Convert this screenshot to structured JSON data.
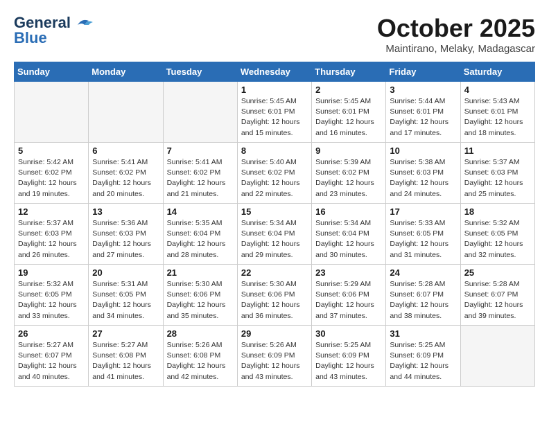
{
  "header": {
    "logo_line1": "General",
    "logo_line2": "Blue",
    "month": "October 2025",
    "location": "Maintirano, Melaky, Madagascar"
  },
  "weekdays": [
    "Sunday",
    "Monday",
    "Tuesday",
    "Wednesday",
    "Thursday",
    "Friday",
    "Saturday"
  ],
  "weeks": [
    [
      {
        "day": "",
        "info": ""
      },
      {
        "day": "",
        "info": ""
      },
      {
        "day": "",
        "info": ""
      },
      {
        "day": "1",
        "info": "Sunrise: 5:45 AM\nSunset: 6:01 PM\nDaylight: 12 hours\nand 15 minutes."
      },
      {
        "day": "2",
        "info": "Sunrise: 5:45 AM\nSunset: 6:01 PM\nDaylight: 12 hours\nand 16 minutes."
      },
      {
        "day": "3",
        "info": "Sunrise: 5:44 AM\nSunset: 6:01 PM\nDaylight: 12 hours\nand 17 minutes."
      },
      {
        "day": "4",
        "info": "Sunrise: 5:43 AM\nSunset: 6:01 PM\nDaylight: 12 hours\nand 18 minutes."
      }
    ],
    [
      {
        "day": "5",
        "info": "Sunrise: 5:42 AM\nSunset: 6:02 PM\nDaylight: 12 hours\nand 19 minutes."
      },
      {
        "day": "6",
        "info": "Sunrise: 5:41 AM\nSunset: 6:02 PM\nDaylight: 12 hours\nand 20 minutes."
      },
      {
        "day": "7",
        "info": "Sunrise: 5:41 AM\nSunset: 6:02 PM\nDaylight: 12 hours\nand 21 minutes."
      },
      {
        "day": "8",
        "info": "Sunrise: 5:40 AM\nSunset: 6:02 PM\nDaylight: 12 hours\nand 22 minutes."
      },
      {
        "day": "9",
        "info": "Sunrise: 5:39 AM\nSunset: 6:02 PM\nDaylight: 12 hours\nand 23 minutes."
      },
      {
        "day": "10",
        "info": "Sunrise: 5:38 AM\nSunset: 6:03 PM\nDaylight: 12 hours\nand 24 minutes."
      },
      {
        "day": "11",
        "info": "Sunrise: 5:37 AM\nSunset: 6:03 PM\nDaylight: 12 hours\nand 25 minutes."
      }
    ],
    [
      {
        "day": "12",
        "info": "Sunrise: 5:37 AM\nSunset: 6:03 PM\nDaylight: 12 hours\nand 26 minutes."
      },
      {
        "day": "13",
        "info": "Sunrise: 5:36 AM\nSunset: 6:03 PM\nDaylight: 12 hours\nand 27 minutes."
      },
      {
        "day": "14",
        "info": "Sunrise: 5:35 AM\nSunset: 6:04 PM\nDaylight: 12 hours\nand 28 minutes."
      },
      {
        "day": "15",
        "info": "Sunrise: 5:34 AM\nSunset: 6:04 PM\nDaylight: 12 hours\nand 29 minutes."
      },
      {
        "day": "16",
        "info": "Sunrise: 5:34 AM\nSunset: 6:04 PM\nDaylight: 12 hours\nand 30 minutes."
      },
      {
        "day": "17",
        "info": "Sunrise: 5:33 AM\nSunset: 6:05 PM\nDaylight: 12 hours\nand 31 minutes."
      },
      {
        "day": "18",
        "info": "Sunrise: 5:32 AM\nSunset: 6:05 PM\nDaylight: 12 hours\nand 32 minutes."
      }
    ],
    [
      {
        "day": "19",
        "info": "Sunrise: 5:32 AM\nSunset: 6:05 PM\nDaylight: 12 hours\nand 33 minutes."
      },
      {
        "day": "20",
        "info": "Sunrise: 5:31 AM\nSunset: 6:05 PM\nDaylight: 12 hours\nand 34 minutes."
      },
      {
        "day": "21",
        "info": "Sunrise: 5:30 AM\nSunset: 6:06 PM\nDaylight: 12 hours\nand 35 minutes."
      },
      {
        "day": "22",
        "info": "Sunrise: 5:30 AM\nSunset: 6:06 PM\nDaylight: 12 hours\nand 36 minutes."
      },
      {
        "day": "23",
        "info": "Sunrise: 5:29 AM\nSunset: 6:06 PM\nDaylight: 12 hours\nand 37 minutes."
      },
      {
        "day": "24",
        "info": "Sunrise: 5:28 AM\nSunset: 6:07 PM\nDaylight: 12 hours\nand 38 minutes."
      },
      {
        "day": "25",
        "info": "Sunrise: 5:28 AM\nSunset: 6:07 PM\nDaylight: 12 hours\nand 39 minutes."
      }
    ],
    [
      {
        "day": "26",
        "info": "Sunrise: 5:27 AM\nSunset: 6:07 PM\nDaylight: 12 hours\nand 40 minutes."
      },
      {
        "day": "27",
        "info": "Sunrise: 5:27 AM\nSunset: 6:08 PM\nDaylight: 12 hours\nand 41 minutes."
      },
      {
        "day": "28",
        "info": "Sunrise: 5:26 AM\nSunset: 6:08 PM\nDaylight: 12 hours\nand 42 minutes."
      },
      {
        "day": "29",
        "info": "Sunrise: 5:26 AM\nSunset: 6:09 PM\nDaylight: 12 hours\nand 43 minutes."
      },
      {
        "day": "30",
        "info": "Sunrise: 5:25 AM\nSunset: 6:09 PM\nDaylight: 12 hours\nand 43 minutes."
      },
      {
        "day": "31",
        "info": "Sunrise: 5:25 AM\nSunset: 6:09 PM\nDaylight: 12 hours\nand 44 minutes."
      },
      {
        "day": "",
        "info": ""
      }
    ]
  ]
}
